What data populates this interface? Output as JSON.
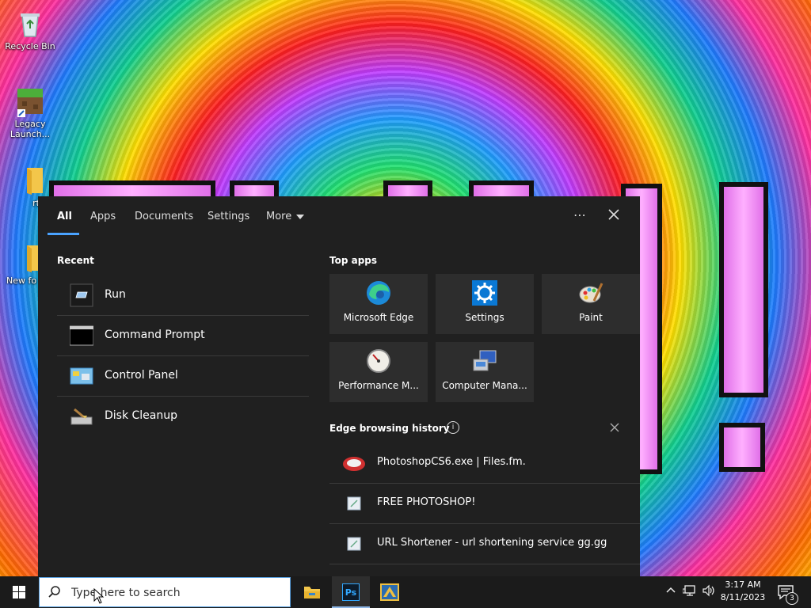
{
  "desktop": {
    "icons": [
      {
        "label": "Recycle Bin"
      },
      {
        "label": "Legacy Launch..."
      },
      {
        "label": "rt"
      },
      {
        "label": "New fo"
      }
    ]
  },
  "search_panel": {
    "tabs": [
      {
        "label": "All"
      },
      {
        "label": "Apps"
      },
      {
        "label": "Documents"
      },
      {
        "label": "Settings"
      },
      {
        "label": "More"
      }
    ],
    "options_icon": "⋯",
    "recent": {
      "title": "Recent",
      "items": [
        {
          "label": "Run"
        },
        {
          "label": "Command Prompt"
        },
        {
          "label": "Control Panel"
        },
        {
          "label": "Disk Cleanup"
        }
      ]
    },
    "top_apps": {
      "title": "Top apps",
      "items": [
        {
          "label": "Microsoft Edge"
        },
        {
          "label": "Settings"
        },
        {
          "label": "Paint"
        },
        {
          "label": "Performance M..."
        },
        {
          "label": "Computer Mana..."
        }
      ]
    },
    "edge_history": {
      "title": "Edge browsing history",
      "info_symbol": "i",
      "items": [
        {
          "label": "PhotoshopCS6.exe | Files.fm."
        },
        {
          "label": "FREE PHOTOSHOP!"
        },
        {
          "label": "URL Shortener - url shortening service gg.gg"
        }
      ]
    }
  },
  "taskbar": {
    "search_placeholder": "Type here to search",
    "ps_label": "Ps",
    "clock": {
      "time": "3:17 AM",
      "date": "8/11/2023"
    },
    "notification_count": "3",
    "accent_color": "#4aa3ff"
  }
}
